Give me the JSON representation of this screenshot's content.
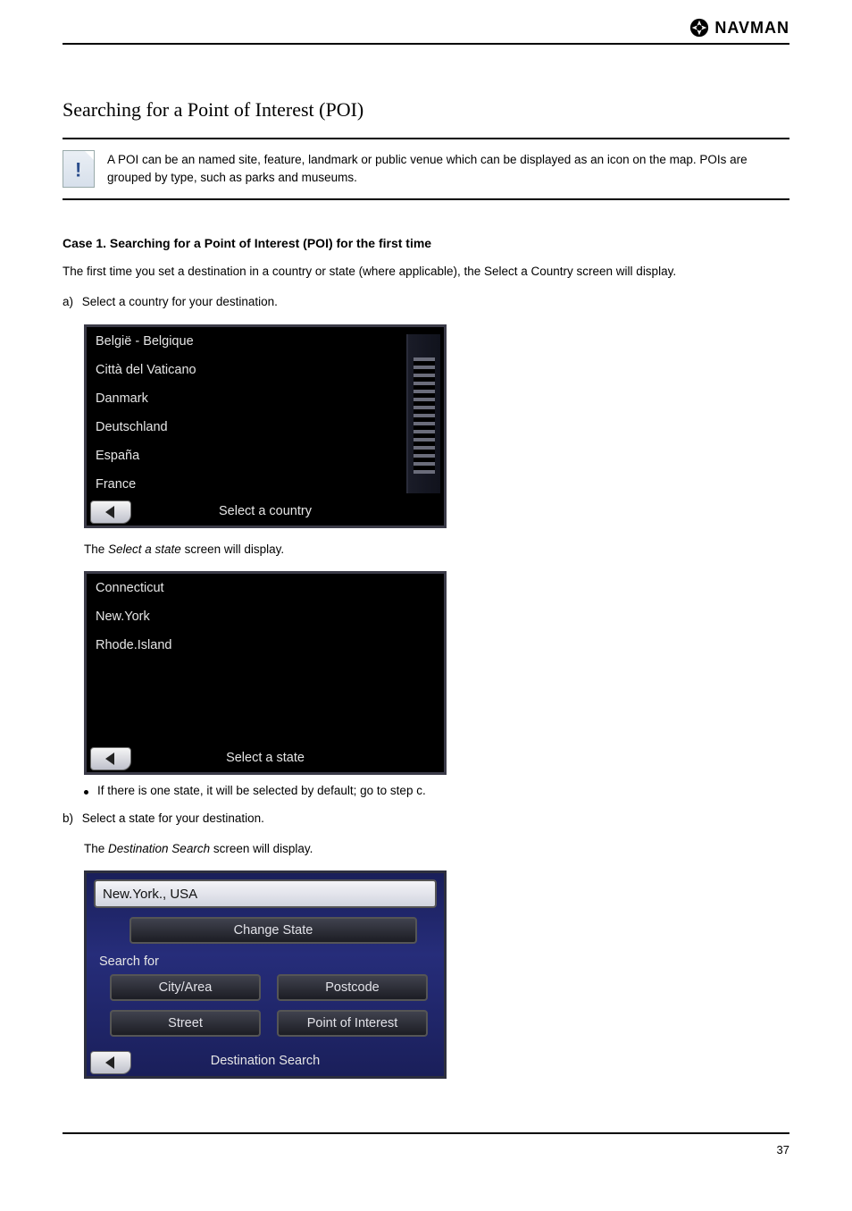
{
  "brand": "NAVMAN",
  "section": {
    "title": "Searching for a Point of Interest (POI)",
    "note": "A POI can be an named site, feature, landmark or public venue which can be displayed as an icon on the map. POIs are grouped by type, such as parks and museums."
  },
  "caseA": {
    "heading": "Case 1. Searching for a Point of Interest (POI) for the first time",
    "intro": "The first time you set a destination in a country or state (where applicable), the Select a Country screen will display.",
    "steps": {
      "a_prefix": "a)",
      "a_text": "Select a country for your destination.",
      "a_followup_prefix": "The ",
      "a_followup_italic": "Select a state",
      "a_followup_suffix": " screen will display.",
      "bullet_text": "If there is one state, it will be selected by default; go to step c.",
      "b_prefix": "b)",
      "b_text": "Select a state for your destination.",
      "b_followup_prefix": "The ",
      "b_followup_italic": "Destination Search",
      "b_followup_suffix": " screen will display."
    }
  },
  "device_country": {
    "items": [
      "België - Belgique",
      "Città del Vaticano",
      "Danmark",
      "Deutschland",
      "España",
      "France"
    ],
    "footer": "Select a country"
  },
  "device_state": {
    "items": [
      "Connecticut",
      "New.York",
      "Rhode.Island"
    ],
    "footer": "Select a state"
  },
  "panel": {
    "location": "New.York., USA",
    "change_state": "Change State",
    "search_label": "Search for",
    "buttons": {
      "city": "City/Area",
      "postcode": "Postcode",
      "street": "Street",
      "poi": "Point of Interest"
    },
    "footer": "Destination Search"
  },
  "pageNumber": "37"
}
